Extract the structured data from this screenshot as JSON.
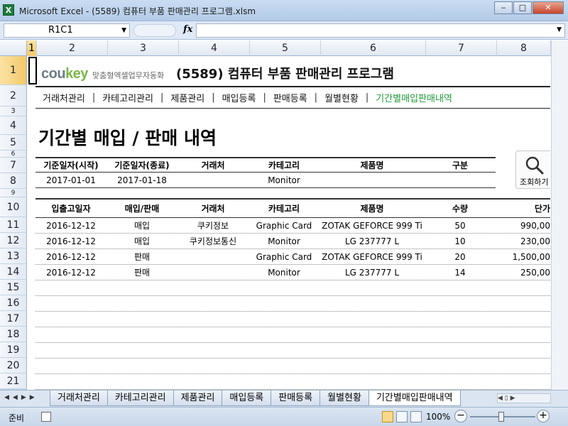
{
  "window": {
    "title": "Microsoft Excel - (5589) 컴퓨터 부품 판매관리 프로그램.xlsm",
    "app_icon": "excel-icon",
    "buttons": [
      "‒",
      "□",
      "✕"
    ]
  },
  "formula_bar": {
    "name_box": "R1C1",
    "fx": "fx",
    "content": ""
  },
  "columns": [
    "1",
    "2",
    "3",
    "4",
    "5",
    "6",
    "7",
    "8"
  ],
  "rows": [
    "1",
    "2",
    "3",
    "4",
    "5",
    "6",
    "7",
    "8",
    "9",
    "10",
    "11",
    "12",
    "13",
    "14",
    "15",
    "16",
    "17",
    "18",
    "19",
    "20",
    "21",
    "22"
  ],
  "header": {
    "brand_prefix": "cou",
    "brand_suffix": "key",
    "brand_sub": "맞춤형엑셀업무자동화",
    "program_title": "(5589) 컴퓨터 부품 판매관리 프로그램"
  },
  "nav": [
    "거래처관리",
    "카테고리관리",
    "제품관리",
    "매입등록",
    "판매등록",
    "월별현황",
    "기간별매입판매내역"
  ],
  "page_heading": "기간별 매입 / 판매 내역",
  "filter": {
    "headers": [
      "기준일자(시작)",
      "기준일자(종료)",
      "거래처",
      "카테고리",
      "제품명",
      "구분"
    ],
    "values": [
      "2017-01-01",
      "2017-01-18",
      "",
      "Monitor",
      "",
      ""
    ]
  },
  "search_button": {
    "label": "조회하기",
    "icon": "search-icon"
  },
  "table": {
    "headers": [
      "입출고일자",
      "매입/판매",
      "거래처",
      "카테고리",
      "제품명",
      "수량",
      "단가"
    ],
    "rows": [
      [
        "2016-12-12",
        "매입",
        "쿠키정보",
        "Graphic Card",
        "ZOTAK GEFORCE 999 Ti",
        "50",
        "990,00"
      ],
      [
        "2016-12-12",
        "매입",
        "쿠키정보통신",
        "Monitor",
        "LG 237777 L",
        "10",
        "230,00"
      ],
      [
        "2016-12-12",
        "판매",
        "",
        "Graphic Card",
        "ZOTAK GEFORCE 999 Ti",
        "20",
        "1,500,00"
      ],
      [
        "2016-12-12",
        "판매",
        "",
        "Monitor",
        "LG 237777 L",
        "14",
        "250,00"
      ]
    ]
  },
  "sheet_tabs": [
    "거래처관리",
    "카테고리관리",
    "제품관리",
    "매입등록",
    "판매등록",
    "월별현황",
    "기간별매입판매내역"
  ],
  "active_tab": "기간별매입판매내역",
  "status": {
    "text": "준비",
    "zoom": "100%"
  }
}
